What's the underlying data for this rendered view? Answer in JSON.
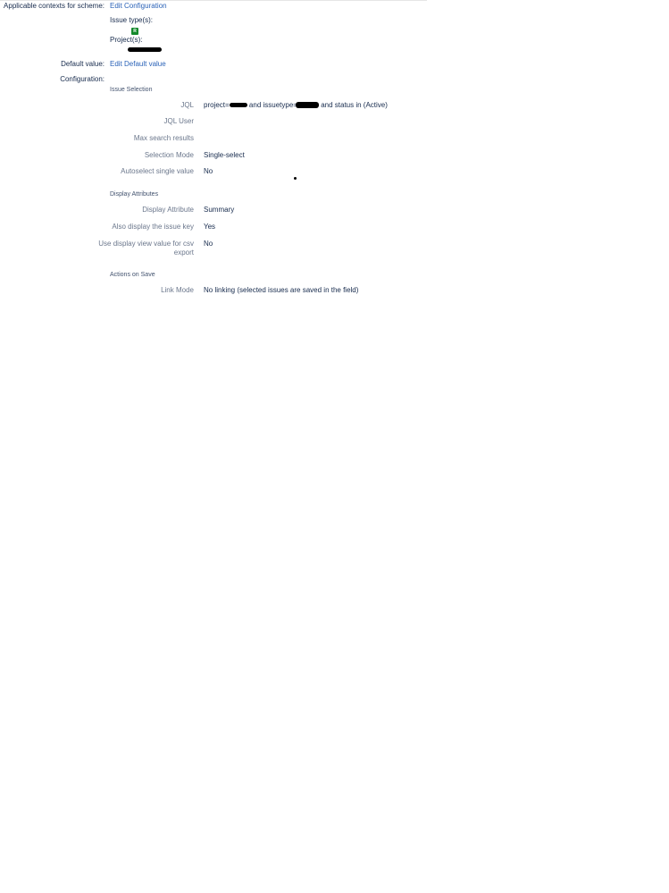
{
  "header": {
    "applicable_contexts_label": "Applicable contexts for scheme:",
    "edit_configuration_link": "Edit Configuration",
    "issue_types_label": "Issue type(s):",
    "issue_type_badge": "R",
    "projects_label": "Project(s):",
    "default_value_label": "Default value:",
    "edit_default_value_link": "Edit Default value",
    "configuration_label": "Configuration:"
  },
  "issue_selection": {
    "heading": "Issue Selection",
    "jql_label": "JQL",
    "jql_value_prefix": "project=",
    "jql_value_middle": "and issuetype=",
    "jql_value_suffix": "and status in (Active)",
    "jql_user_label": "JQL User",
    "jql_user_value": "",
    "max_results_label": "Max search results",
    "max_results_value": "",
    "selection_mode_label": "Selection Mode",
    "selection_mode_value": "Single-select",
    "autoselect_label": "Autoselect single value",
    "autoselect_value": "No"
  },
  "display_attributes": {
    "heading": "Display Attributes",
    "display_attribute_label": "Display Attribute",
    "display_attribute_value": "Summary",
    "also_display_key_label": "Also display the issue key",
    "also_display_key_value": "Yes",
    "csv_export_label_line1": "Use display view value for csv",
    "csv_export_label_line2": "export",
    "csv_export_value": "No"
  },
  "actions_on_save": {
    "heading": "Actions on Save",
    "link_mode_label": "Link Mode",
    "link_mode_value": "No linking (selected issues are saved in the field)"
  },
  "colors": {
    "link": "#2b63b8",
    "label": "#6b778c",
    "text": "#172b4d",
    "badge": "#14892c"
  }
}
